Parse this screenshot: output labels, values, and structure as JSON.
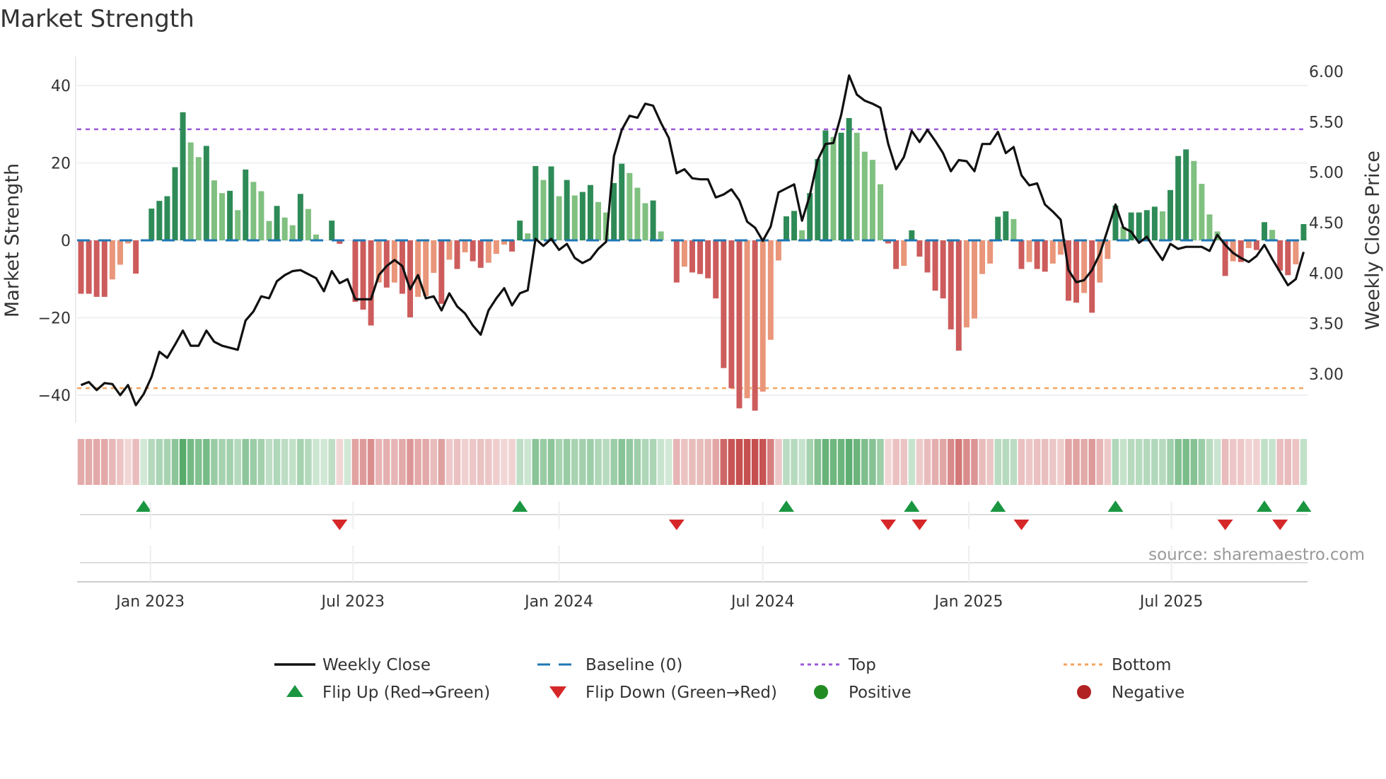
{
  "title": "Market Strength",
  "source": "source: sharemaestro.com",
  "colors": {
    "rising_positive": "#2e8b57",
    "falling_positive": "#80c080",
    "falling_negative": "#cd5c5c",
    "rising_negative": "#e9967a",
    "baseline": "#1f77b4",
    "top": "#9b59d6",
    "bottom": "#f4a460",
    "close": "#111111",
    "flip_up": "#1a9641",
    "flip_down": "#d62728",
    "positive": "#228b22",
    "negative": "#b22222"
  },
  "legend": [
    {
      "label": "Weekly Close",
      "icon": "solid-line"
    },
    {
      "label": "Baseline (0)",
      "icon": "dashed-line"
    },
    {
      "label": "Top",
      "icon": "dotted-line-purple"
    },
    {
      "label": "Bottom",
      "icon": "dotted-line-orange"
    },
    {
      "label": "Flip Up (Red→Green)",
      "icon": "triangle-up"
    },
    {
      "label": "Flip Down (Green→Red)",
      "icon": "triangle-down"
    },
    {
      "label": "Positive",
      "icon": "circle-green"
    },
    {
      "label": "Negative",
      "icon": "circle-red"
    }
  ],
  "chart_data": {
    "type": "bar+line",
    "title": "Market Strength",
    "ylabel": "Market Strength",
    "ylabel_right": "Weekly Close Price",
    "ylim": [
      -48,
      48
    ],
    "ylim_right": [
      2.65,
      6.15
    ],
    "y_ticks": [
      "40",
      "20",
      "0",
      "−20",
      "−40"
    ],
    "y_tick_values": [
      40,
      20,
      0,
      -20,
      -40
    ],
    "y_right_ticks": [
      "6.00",
      "5.50",
      "5.00",
      "4.50",
      "4.00",
      "3.50",
      "3.00"
    ],
    "y_right_tick_values": [
      6.0,
      5.5,
      5.0,
      4.5,
      4.0,
      3.5,
      3.0
    ],
    "x_ticks": [
      "Jan 2023",
      "Jul 2023",
      "Jan 2024",
      "Jul 2024",
      "Jan 2025",
      "Jul 2025"
    ],
    "x_tick_dates": [
      "2023-01-01",
      "2023-07-01",
      "2024-01-01",
      "2024-07-01",
      "2025-01-01",
      "2025-07-01"
    ],
    "start_date": "2022-10-31",
    "frequency": "weekly",
    "top_level": 28.7,
    "bottom_level": -38.2,
    "baseline": 0,
    "strength": [
      -13.8,
      -13.8,
      -14.6,
      -14.6,
      -10.1,
      -6.3,
      -0.8,
      -8.6,
      0,
      8.2,
      10.2,
      11.4,
      18.9,
      33.1,
      25.3,
      21.5,
      24.4,
      15.5,
      12.2,
      12.8,
      7.8,
      18.3,
      15.1,
      12.7,
      5.0,
      8.9,
      5.9,
      3.9,
      12.0,
      8.1,
      1.5,
      0,
      5.1,
      -0.9,
      0,
      -15.9,
      -17.9,
      -22.0,
      -10.9,
      -12.2,
      -10.9,
      -13.8,
      -19.9,
      -14.6,
      -14.4,
      -8.4,
      -16.4,
      -5.0,
      -7.4,
      -3.1,
      -5.4,
      -7.1,
      -5.8,
      -3.5,
      -1.1,
      -2.9,
      5.1,
      1.8,
      19.2,
      15.6,
      19.1,
      11.4,
      15.6,
      11.6,
      12.5,
      14.3,
      9.9,
      7.2,
      14.8,
      19.8,
      17.4,
      13.6,
      9.6,
      10.3,
      2.3,
      0,
      -10.9,
      -6.8,
      -8.3,
      -8.7,
      -9.8,
      -15.0,
      -33.0,
      -38.2,
      -43.4,
      -40.8,
      -44.0,
      -39.1,
      -25.7,
      -5.2,
      6.2,
      7.6,
      2.6,
      12.2,
      21.0,
      28.4,
      26.7,
      27.8,
      31.6,
      27.8,
      22.9,
      20.8,
      14.5,
      -0.8,
      -7.4,
      -6.6,
      2.6,
      -4.2,
      -8.3,
      -13.0,
      -15.0,
      -23.0,
      -28.5,
      -22.5,
      -20.2,
      -8.7,
      -6.0,
      6.1,
      7.5,
      5.5,
      -7.4,
      -5.6,
      -7.4,
      -8.1,
      -6.0,
      -3.7,
      -15.6,
      -16.1,
      -13.6,
      -18.7,
      -10.9,
      -4.8,
      9.0,
      3.5,
      7.2,
      7.2,
      7.8,
      8.7,
      7.5,
      13.0,
      21.8,
      23.5,
      20.5,
      14.6,
      6.7,
      2.3,
      -9.2,
      -5.4,
      -5.6,
      -2.0,
      -2.5,
      4.7,
      2.7,
      -7.8,
      -9.0,
      -6.2,
      4.2
    ],
    "weekly_close": [
      2.89,
      2.92,
      2.84,
      2.91,
      2.9,
      2.79,
      2.89,
      2.69,
      2.8,
      2.97,
      3.22,
      3.16,
      3.29,
      3.43,
      3.28,
      3.28,
      3.43,
      3.32,
      3.28,
      3.26,
      3.24,
      3.53,
      3.62,
      3.77,
      3.75,
      3.92,
      3.98,
      4.02,
      4.03,
      3.99,
      3.95,
      3.82,
      4.02,
      3.9,
      3.94,
      3.74,
      3.74,
      3.74,
      3.98,
      4.07,
      4.13,
      4.07,
      3.84,
      3.98,
      3.75,
      3.77,
      3.63,
      3.8,
      3.67,
      3.6,
      3.48,
      3.39,
      3.63,
      3.75,
      3.85,
      3.68,
      3.8,
      3.83,
      4.34,
      4.27,
      4.34,
      4.23,
      4.29,
      4.15,
      4.1,
      4.14,
      4.24,
      4.31,
      5.16,
      5.42,
      5.56,
      5.54,
      5.68,
      5.66,
      5.49,
      5.34,
      4.99,
      5.03,
      4.94,
      4.93,
      4.93,
      4.75,
      4.78,
      4.83,
      4.72,
      4.51,
      4.45,
      4.32,
      4.46,
      4.8,
      4.84,
      4.88,
      4.52,
      4.77,
      5.12,
      5.28,
      5.29,
      5.57,
      5.96,
      5.77,
      5.71,
      5.68,
      5.64,
      5.28,
      5.03,
      5.15,
      5.41,
      5.3,
      5.42,
      5.31,
      5.19,
      5.01,
      5.12,
      5.11,
      5.01,
      5.28,
      5.28,
      5.4,
      5.19,
      5.25,
      4.97,
      4.87,
      4.89,
      4.68,
      4.61,
      4.53,
      4.03,
      3.91,
      3.93,
      4.03,
      4.19,
      4.43,
      4.68,
      4.45,
      4.41,
      4.3,
      4.36,
      4.24,
      4.13,
      4.29,
      4.24,
      4.26,
      4.26,
      4.26,
      4.22,
      4.38,
      4.28,
      4.2,
      4.15,
      4.11,
      4.17,
      4.28,
      4.14,
      4.01,
      3.88,
      3.94,
      4.21
    ],
    "flip_up_weeks": [
      8,
      56,
      90,
      106,
      117,
      132,
      151,
      156
    ],
    "flip_down_weeks": [
      33,
      76,
      103,
      107,
      120,
      146,
      153
    ],
    "legend_position": "bottom"
  }
}
